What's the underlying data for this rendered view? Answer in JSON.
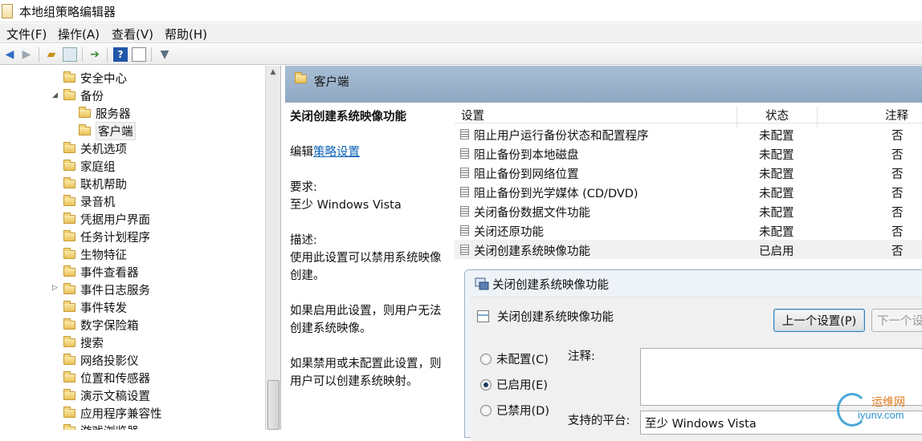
{
  "window": {
    "title": "本地组策略编辑器"
  },
  "menu": [
    "文件(F)",
    "操作(A)",
    "查看(V)",
    "帮助(H)"
  ],
  "toolbar_icons": [
    "back-arrow-icon",
    "forward-arrow-icon",
    "up-folder-icon",
    "show-hide-tree-icon",
    "export-list-icon",
    "help-icon",
    "properties-view-icon",
    "filter-icon"
  ],
  "tree": {
    "items": [
      {
        "label": "安全中心",
        "depth": 0
      },
      {
        "label": "备份",
        "depth": 0,
        "expander": "◢"
      },
      {
        "label": "服务器",
        "depth": 1
      },
      {
        "label": "客户端",
        "depth": 1,
        "selected": true
      },
      {
        "label": "关机选项",
        "depth": 0
      },
      {
        "label": "家庭组",
        "depth": 0
      },
      {
        "label": "联机帮助",
        "depth": 0
      },
      {
        "label": "录音机",
        "depth": 0
      },
      {
        "label": "凭据用户界面",
        "depth": 0
      },
      {
        "label": "任务计划程序",
        "depth": 0
      },
      {
        "label": "生物特征",
        "depth": 0
      },
      {
        "label": "事件查看器",
        "depth": 0
      },
      {
        "label": "事件日志服务",
        "depth": 0,
        "expander": "▷"
      },
      {
        "label": "事件转发",
        "depth": 0
      },
      {
        "label": "数字保险箱",
        "depth": 0
      },
      {
        "label": "搜索",
        "depth": 0
      },
      {
        "label": "网络投影仪",
        "depth": 0
      },
      {
        "label": "位置和传感器",
        "depth": 0
      },
      {
        "label": "演示文稿设置",
        "depth": 0
      },
      {
        "label": "应用程序兼容性",
        "depth": 0
      },
      {
        "label": "游戏浏览器",
        "depth": 0
      }
    ]
  },
  "header": {
    "title": "客户端"
  },
  "description": {
    "title": "关闭创建系统映像功能",
    "edit_prefix": "编辑",
    "edit_link": "策略设置",
    "requirements_label": "要求:",
    "requirements_value": "至少 Windows Vista",
    "desc_label": "描述:",
    "desc_text": "使用此设置可以禁用系统映像创建。",
    "enabled_text": "如果启用此设置，则用户无法创建系统映像。",
    "disabled_text": "如果禁用或未配置此设置，则用户可以创建系统映射。"
  },
  "list": {
    "columns": [
      "设置",
      "状态",
      "注释"
    ],
    "rows": [
      {
        "setting": "阻止用户运行备份状态和配置程序",
        "state": "未配置",
        "comment": "否"
      },
      {
        "setting": "阻止备份到本地磁盘",
        "state": "未配置",
        "comment": "否"
      },
      {
        "setting": "阻止备份到网络位置",
        "state": "未配置",
        "comment": "否"
      },
      {
        "setting": "阻止备份到光学媒体 (CD/DVD)",
        "state": "未配置",
        "comment": "否"
      },
      {
        "setting": "关闭备份数据文件功能",
        "state": "未配置",
        "comment": "否"
      },
      {
        "setting": "关闭还原功能",
        "state": "未配置",
        "comment": "否"
      },
      {
        "setting": "关闭创建系统映像功能",
        "state": "已启用",
        "comment": "否",
        "selected": true
      }
    ]
  },
  "dialog": {
    "title": "关闭创建系统映像功能",
    "subtitle": "关闭创建系统映像功能",
    "prev_button": "上一个设置(P)",
    "next_button": "下一个设置(N)",
    "options": [
      {
        "label": "未配置(C)",
        "checked": false
      },
      {
        "label": "已启用(E)",
        "checked": true
      },
      {
        "label": "已禁用(D)",
        "checked": false
      }
    ],
    "comment_label": "注释:",
    "platform_label": "支持的平台:",
    "platform_value": "至少 Windows Vista"
  },
  "watermark": {
    "cn": "运维网",
    "en": "iyunv.com"
  }
}
